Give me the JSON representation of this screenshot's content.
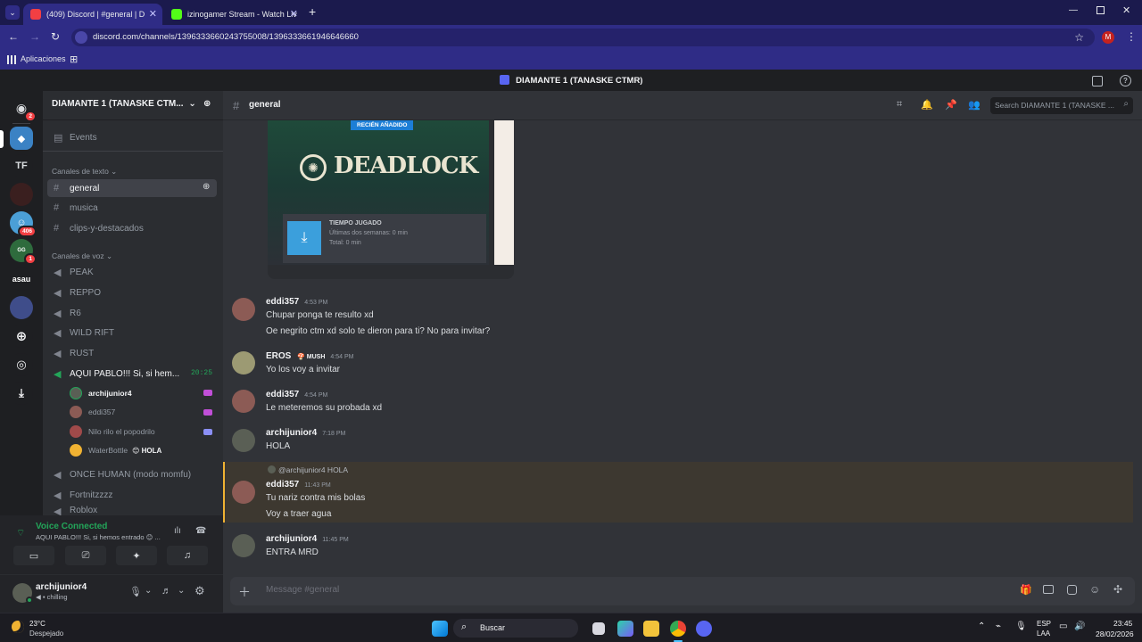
{
  "browser": {
    "tabs": [
      {
        "label": "(409) Discord | #general | D",
        "active": true
      },
      {
        "label": "izinogamer Stream - Watch Liv",
        "active": false
      }
    ],
    "new_tab": "+",
    "url": "discord.com/channels/1396333660243755008/1396333661946646660",
    "bookmarks": {
      "apps_label": "Aplicaciones"
    },
    "profile_initial": "M"
  },
  "discord": {
    "window_title": "DIAMANTE 1 (TANASKE CTMR)",
    "servers": [
      {
        "name": "home",
        "badge": "2"
      },
      {
        "name": "diamante",
        "badge": ""
      },
      {
        "name": "tf",
        "label": "TF",
        "badge": ""
      },
      {
        "name": "server4",
        "badge": ""
      },
      {
        "name": "server5",
        "badge": "406"
      },
      {
        "name": "server6",
        "badge": "1"
      },
      {
        "name": "asau",
        "label": "asau",
        "badge": ""
      },
      {
        "name": "server8",
        "badge": ""
      }
    ],
    "server_header": "DIAMANTE 1 (TANASKE CTM...",
    "events_label": "Events",
    "text_category": "Canales de texto",
    "text_channels": [
      "general",
      "musica",
      "clips-y-destacados"
    ],
    "voice_category": "Canales de voz",
    "voice_channels": [
      "PEAK",
      "REPPO",
      "R6",
      "WILD RIFT",
      "RUST",
      "AQUI PABLO!!! Si, si hem...",
      "ONCE HUMAN (modo momfu)",
      "Fortnitzzzz",
      "Roblox"
    ],
    "active_voice_timer": "20:25",
    "voice_users": [
      {
        "name": "archijunior4",
        "status": ""
      },
      {
        "name": "eddi357",
        "status": ""
      },
      {
        "name": "Nilo rilo el popodrilo",
        "status": ""
      },
      {
        "name": "WaterBottle",
        "status": "HOLA"
      }
    ],
    "voice_panel": {
      "title": "Voice Connected",
      "subtitle": "AQUI PABLO!!! Si, si hemos entrado 😊 ..."
    },
    "user": {
      "name": "archijunior4",
      "status": "chilling"
    },
    "channel_name": "general",
    "search_placeholder": "Search DIAMANTE 1 (TANASKE ...",
    "embed": {
      "badge": "RECIÉN AÑADIDO",
      "game": "DEADLOCK",
      "played_label": "TIEMPO JUGADO",
      "last_two_weeks": "Últimas dos semanas: 0 min",
      "total": "Total: 0 min"
    },
    "messages": [
      {
        "author": "eddi357",
        "time": "4:53 PM",
        "lines": [
          "Chupar ponga te resulto xd",
          "Oe negrito ctm xd solo te dieron para ti? No para invitar?"
        ]
      },
      {
        "author": "EROS",
        "tag": "MUSH",
        "time": "4:54 PM",
        "lines": [
          "Yo los voy a invitar"
        ]
      },
      {
        "author": "eddi357",
        "time": "4:54 PM",
        "lines": [
          "Le meteremos su probada xd"
        ]
      },
      {
        "author": "archijunior4",
        "time": "7:18 PM",
        "lines": [
          "HOLA"
        ]
      },
      {
        "author": "eddi357",
        "time": "11:43 PM",
        "reply": "@archijunior4 HOLA",
        "lines": [
          "Tu nariz contra mis bolas",
          "Voy a traer agua"
        ]
      },
      {
        "author": "archijunior4",
        "time": "11:45 PM",
        "lines": [
          "ENTRA MRD"
        ]
      }
    ],
    "composer_placeholder": "Message #general"
  },
  "taskbar": {
    "weather_temp": "23°C",
    "weather_desc": "Despejado",
    "search_label": "Buscar",
    "lang_top": "ESP",
    "lang_bottom": "LAA",
    "time": "23:45",
    "date": "28/02/2026"
  },
  "colors": {
    "accent": "#5865f2",
    "online": "#23a559",
    "browser": "#2f2c86",
    "mention": "#f0b232"
  }
}
